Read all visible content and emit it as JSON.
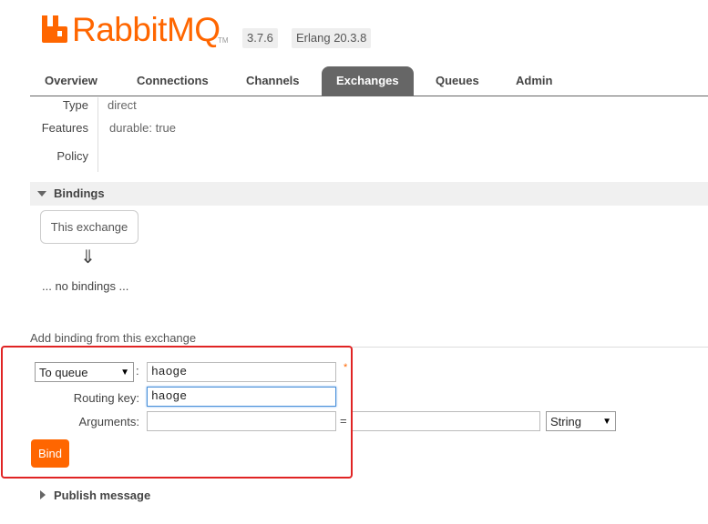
{
  "header": {
    "logo_text": "RabbitMQ",
    "logo_tm": "TM",
    "version": "3.7.6",
    "erlang": "Erlang 20.3.8",
    "brand_color": "#ff6600"
  },
  "tabs": [
    {
      "label": "Overview",
      "active": false
    },
    {
      "label": "Connections",
      "active": false
    },
    {
      "label": "Channels",
      "active": false
    },
    {
      "label": "Exchanges",
      "active": true
    },
    {
      "label": "Queues",
      "active": false
    },
    {
      "label": "Admin",
      "active": false
    }
  ],
  "details": {
    "type_label": "Type",
    "type_value": "direct",
    "features_label": "Features",
    "features_value": "durable: true",
    "policy_label": "Policy"
  },
  "bindings": {
    "title": "Bindings",
    "this_exchange": "This exchange",
    "arrow": "⇓",
    "empty": "... no bindings ..."
  },
  "add_binding": {
    "title": "Add binding from this exchange",
    "destination_type": "To queue",
    "destination_value": "haoge",
    "routing_key_label": "Routing key:",
    "routing_key_value": "haoge",
    "arguments_label": "Arguments:",
    "arguments_key": "",
    "arguments_value": "",
    "equals": "=",
    "arg_type": "String",
    "required_mark": "*",
    "colon": ":",
    "bind_button": "Bind"
  },
  "publish": {
    "title": "Publish message"
  }
}
